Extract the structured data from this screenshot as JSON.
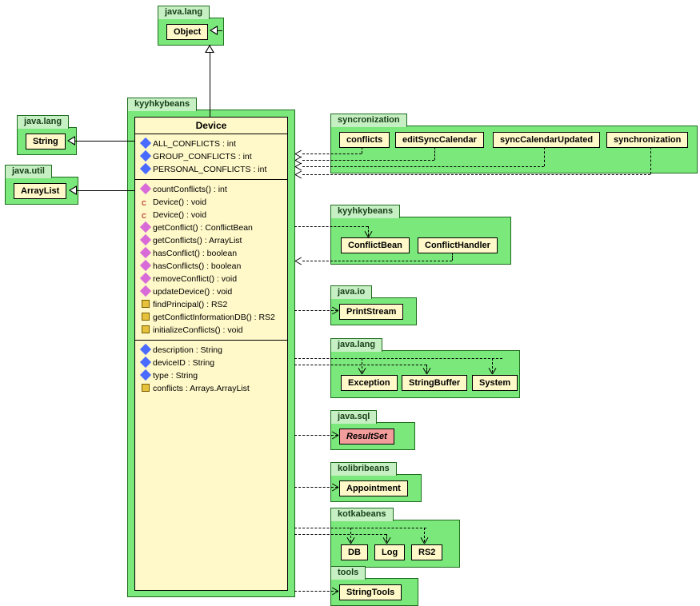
{
  "packages": {
    "javaLangTop": {
      "label": "java.lang",
      "classes": [
        "Object"
      ]
    },
    "javaLangLeft": {
      "label": "java.lang",
      "classes": [
        "String"
      ]
    },
    "javaUtil": {
      "label": "java.util",
      "classes": [
        "ArrayList"
      ]
    },
    "kyyhkybeans": {
      "label": "kyyhkybeans",
      "classTitle": "Device",
      "constants": [
        {
          "icon": "field",
          "text": "ALL_CONFLICTS : int"
        },
        {
          "icon": "field",
          "text": "GROUP_CONFLICTS : int"
        },
        {
          "icon": "field",
          "text": "PERSONAL_CONFLICTS : int"
        }
      ],
      "methods": [
        {
          "icon": "pub",
          "text": "countConflicts() : int"
        },
        {
          "icon": "ctor",
          "text": "Device() : void"
        },
        {
          "icon": "ctor",
          "text": "Device() : void"
        },
        {
          "icon": "pub",
          "text": "getConflict() : ConflictBean"
        },
        {
          "icon": "pub",
          "text": "getConflicts() : ArrayList"
        },
        {
          "icon": "pub",
          "text": "hasConflict() : boolean"
        },
        {
          "icon": "pub",
          "text": "hasConflicts() : boolean"
        },
        {
          "icon": "pub",
          "text": "removeConflict() : void"
        },
        {
          "icon": "pub",
          "text": "updateDevice() : void"
        },
        {
          "icon": "priv",
          "text": "findPrincipal() : RS2"
        },
        {
          "icon": "priv",
          "text": "getConflictInformationDB() : RS2"
        },
        {
          "icon": "priv",
          "text": "initializeConflicts() : void"
        }
      ],
      "fields": [
        {
          "icon": "field",
          "text": "description : String"
        },
        {
          "icon": "field",
          "text": "deviceID : String"
        },
        {
          "icon": "field",
          "text": "type : String"
        },
        {
          "icon": "priv",
          "text": "conflicts : Arrays.ArrayList"
        }
      ]
    },
    "syncronization": {
      "label": "syncronization",
      "classes": [
        "conflicts",
        "editSyncCalendar",
        "syncCalendarUpdated",
        "synchronization"
      ]
    },
    "kyyhkybeans2": {
      "label": "kyyhkybeans",
      "classes": [
        "ConflictBean",
        "ConflictHandler"
      ]
    },
    "javaIo": {
      "label": "java.io",
      "classes": [
        "PrintStream"
      ]
    },
    "javaLang2": {
      "label": "java.lang",
      "classes": [
        "Exception",
        "StringBuffer",
        "System"
      ]
    },
    "javaSql": {
      "label": "java.sql",
      "classes": [
        "ResultSet"
      ]
    },
    "kolibribeans": {
      "label": "kolibribeans",
      "classes": [
        "Appointment"
      ]
    },
    "kotkabeans": {
      "label": "kotkabeans",
      "classes": [
        "DB",
        "Log",
        "RS2"
      ]
    },
    "tools": {
      "label": "tools",
      "classes": [
        "StringTools"
      ]
    }
  }
}
